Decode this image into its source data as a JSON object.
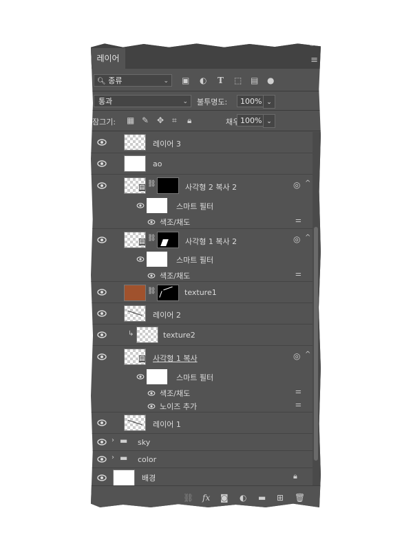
{
  "panel": {
    "tab_label": "레이어",
    "filter": {
      "kind_label": "종류"
    },
    "blend": {
      "mode": "통과",
      "opacity_label": "불투명도:",
      "opacity_value": "100%"
    },
    "lock": {
      "label": "잠그기:",
      "fill_label": "채우기:",
      "fill_value": "100%"
    }
  },
  "layers": [
    {
      "name": "레이어 3"
    },
    {
      "name": "ao"
    },
    {
      "name": "사각형 2 복사 2",
      "smart_filter": "스마트 필터",
      "filters": [
        "색조/채도"
      ]
    },
    {
      "name": "사각형 1 복사 2",
      "smart_filter": "스마트 필터",
      "filters": [
        "색조/채도"
      ]
    },
    {
      "name": "texture1"
    },
    {
      "name": "레이어 2"
    },
    {
      "name": "texture2"
    },
    {
      "name": "사각형 1 복사",
      "smart_filter": "스마트 필터",
      "filters": [
        "색조/채도",
        "노이즈 추가"
      ]
    },
    {
      "name": "레이어 1"
    },
    {
      "name": "sky"
    },
    {
      "name": "color"
    },
    {
      "name": "배경"
    }
  ],
  "bottom": {
    "fx_label": "fx"
  },
  "colors": {
    "panel_bg": "#535353",
    "tab_bar": "#424242",
    "text": "#dcdcdc",
    "accent_texture": "#a0522d"
  }
}
